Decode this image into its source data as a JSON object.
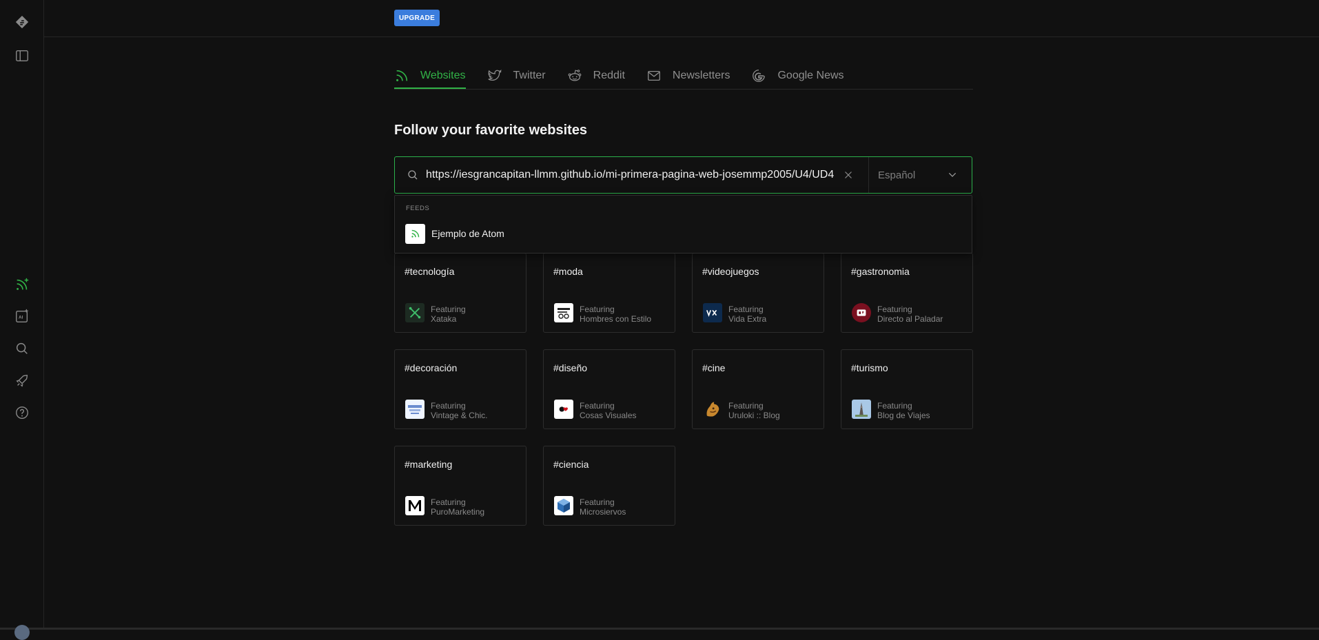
{
  "header": {
    "upgrade_label": "UPGRADE"
  },
  "tabs": [
    {
      "label": "Websites",
      "icon": "rss-icon",
      "active": true
    },
    {
      "label": "Twitter",
      "icon": "twitter-icon",
      "active": false
    },
    {
      "label": "Reddit",
      "icon": "reddit-icon",
      "active": false
    },
    {
      "label": "Newsletters",
      "icon": "mail-icon",
      "active": false
    },
    {
      "label": "Google News",
      "icon": "google-icon",
      "active": false
    }
  ],
  "main": {
    "title": "Follow your favorite websites",
    "search": {
      "value": "https://iesgrancapitan-llmm.github.io/mi-primera-pagina-web-josemmp2005/U4/UD4",
      "language": "Español"
    },
    "dropdown": {
      "section_label": "FEEDS",
      "items": [
        {
          "label": "Ejemplo de Atom",
          "icon": "rss-feed-icon"
        }
      ]
    },
    "featured_label": "Featuring",
    "categories": [
      {
        "tag": "#tecnología",
        "site": "Xataka"
      },
      {
        "tag": "#moda",
        "site": "Hombres con Estilo"
      },
      {
        "tag": "#videojuegos",
        "site": "Vida Extra"
      },
      {
        "tag": "#gastronomia",
        "site": "Directo al Paladar"
      },
      {
        "tag": "#decoración",
        "site": "Vintage & Chic."
      },
      {
        "tag": "#diseño",
        "site": "Cosas Visuales"
      },
      {
        "tag": "#cine",
        "site": "Uruloki :: Blog"
      },
      {
        "tag": "#turismo",
        "site": "Blog de Viajes"
      },
      {
        "tag": "#marketing",
        "site": "PuroMarketing"
      },
      {
        "tag": "#ciencia",
        "site": "Microsiervos"
      }
    ]
  },
  "sidebar": {
    "items": [
      "feedly-logo-icon",
      "panel-toggle-icon",
      "add-feed-icon",
      "ai-feed-icon",
      "search-icon",
      "rocket-icon",
      "help-icon"
    ]
  },
  "colors": {
    "accent": "#31b347",
    "upgrade": "#3b7ddd",
    "background": "#111111"
  }
}
